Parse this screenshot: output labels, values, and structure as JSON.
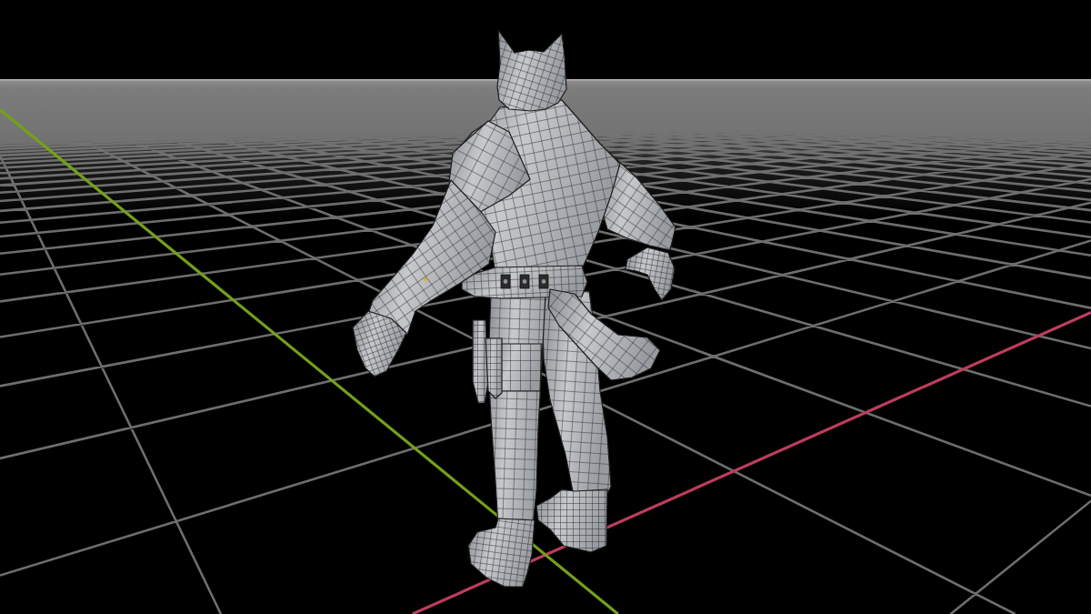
{
  "viewport": {
    "axes": [
      {
        "kind": "x",
        "color": "#bd3d5c"
      },
      {
        "kind": "y",
        "color": "#74a01c"
      }
    ],
    "model": {
      "wireframe": true
    }
  }
}
